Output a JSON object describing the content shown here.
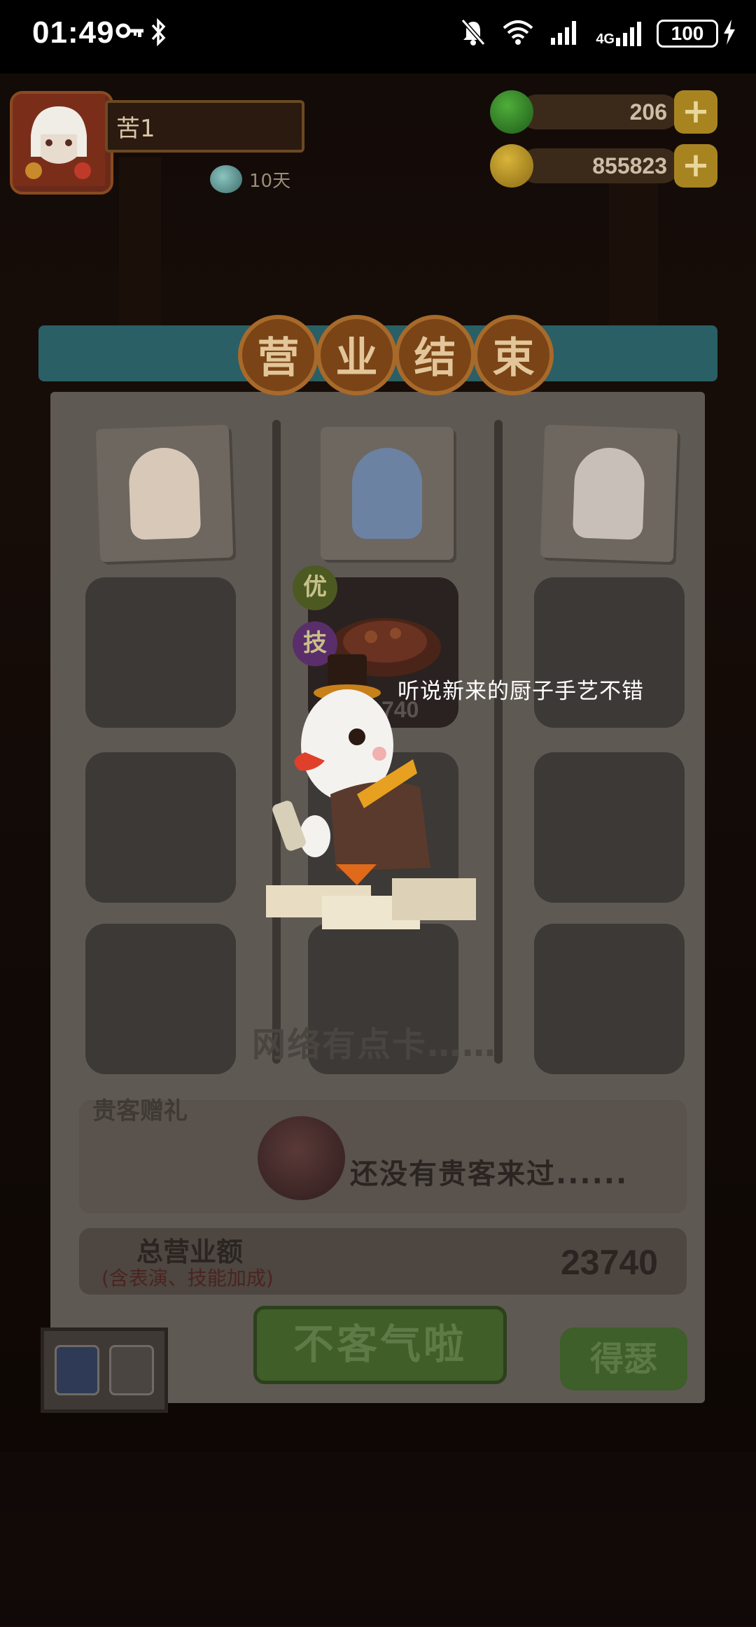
{
  "status_bar": {
    "time": "01:49",
    "battery": "100",
    "network": "4G"
  },
  "hud": {
    "player_name": "苦1",
    "days_text": "10天",
    "currency_green": "206",
    "currency_gold": "855823",
    "plus_label": "+"
  },
  "panel": {
    "title_chars": [
      "营",
      "业",
      "结",
      "束"
    ],
    "tags": [
      "优",
      "技"
    ],
    "dish_value": "740",
    "speech": "听说新来的厨子手艺不错",
    "network_lag": "网络有点卡……",
    "guest_gift_label": "贵客赠礼",
    "guest_empty_text": "还没有贵客来过......",
    "total_label": "总营业额",
    "total_sub": "(含表演、技能加成)",
    "total_value": "23740",
    "main_button": "不客气啦",
    "side_button": "得瑟"
  },
  "colors": {
    "panel": "#5f5953",
    "title_bg": "#7a4416",
    "green_button": "#3f5e28"
  }
}
